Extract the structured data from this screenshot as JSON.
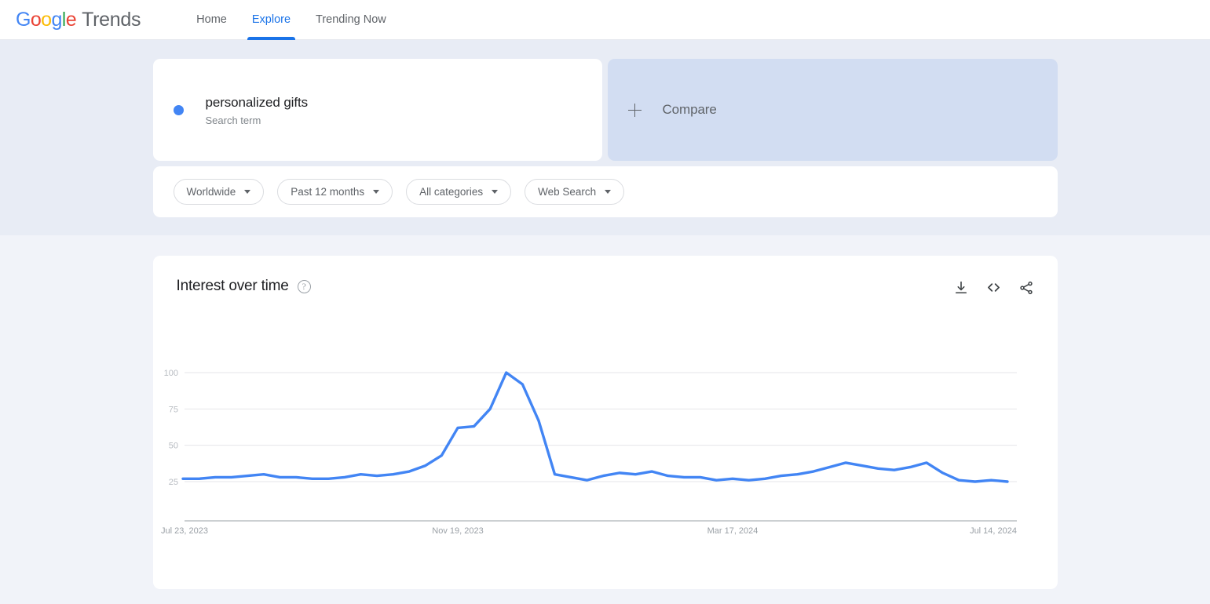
{
  "brand": {
    "google_letters": [
      "G",
      "o",
      "o",
      "g",
      "l",
      "e"
    ],
    "product": "Trends"
  },
  "nav": {
    "items": [
      {
        "label": "Home",
        "active": false
      },
      {
        "label": "Explore",
        "active": true
      },
      {
        "label": "Trending Now",
        "active": false
      }
    ]
  },
  "term": {
    "name": "personalized gifts",
    "type": "Search term",
    "color": "#4285f4"
  },
  "compare": {
    "label": "Compare"
  },
  "filters": [
    {
      "label": "Worldwide"
    },
    {
      "label": "Past 12 months"
    },
    {
      "label": "All categories"
    },
    {
      "label": "Web Search"
    }
  ],
  "chart_card": {
    "title": "Interest over time",
    "help_glyph": "?",
    "actions": [
      {
        "name": "download-icon",
        "title": "Download"
      },
      {
        "name": "embed-icon",
        "title": "Embed"
      },
      {
        "name": "share-icon",
        "title": "Share"
      }
    ]
  },
  "chart_data": {
    "type": "line",
    "title": "Interest over time",
    "xlabel": "",
    "ylabel": "",
    "ylim": [
      0,
      100
    ],
    "yticks": [
      25,
      50,
      75,
      100
    ],
    "grid": true,
    "legend": false,
    "line_color": "#4285f4",
    "line_width": 3.4,
    "xtick_labels": [
      "Jul 23, 2023",
      "Nov 19, 2023",
      "Mar 17, 2024",
      "Jul 14, 2024"
    ],
    "xtick_indices": [
      0,
      17,
      34,
      51
    ],
    "x": [
      "Jul 23, 2023",
      "Jul 30, 2023",
      "Aug 6, 2023",
      "Aug 13, 2023",
      "Aug 20, 2023",
      "Aug 27, 2023",
      "Sep 3, 2023",
      "Sep 10, 2023",
      "Sep 17, 2023",
      "Sep 24, 2023",
      "Oct 1, 2023",
      "Oct 8, 2023",
      "Oct 15, 2023",
      "Oct 22, 2023",
      "Oct 29, 2023",
      "Nov 5, 2023",
      "Nov 12, 2023",
      "Nov 19, 2023",
      "Nov 26, 2023",
      "Dec 3, 2023",
      "Dec 10, 2023",
      "Dec 17, 2023",
      "Dec 24, 2023",
      "Dec 31, 2023",
      "Jan 7, 2024",
      "Jan 14, 2024",
      "Jan 21, 2024",
      "Jan 28, 2024",
      "Feb 4, 2024",
      "Feb 11, 2024",
      "Feb 18, 2024",
      "Feb 25, 2024",
      "Mar 3, 2024",
      "Mar 10, 2024",
      "Mar 17, 2024",
      "Mar 24, 2024",
      "Mar 31, 2024",
      "Apr 7, 2024",
      "Apr 14, 2024",
      "Apr 21, 2024",
      "Apr 28, 2024",
      "May 5, 2024",
      "May 12, 2024",
      "May 19, 2024",
      "May 26, 2024",
      "Jun 2, 2024",
      "Jun 9, 2024",
      "Jun 16, 2024",
      "Jun 23, 2024",
      "Jun 30, 2024",
      "Jul 7, 2024",
      "Jul 14, 2024"
    ],
    "series": [
      {
        "name": "personalized gifts",
        "color": "#4285f4",
        "values": [
          27,
          27,
          28,
          28,
          29,
          30,
          28,
          28,
          27,
          27,
          28,
          30,
          29,
          30,
          32,
          36,
          43,
          62,
          63,
          75,
          100,
          92,
          67,
          30,
          28,
          26,
          29,
          31,
          30,
          32,
          29,
          28,
          28,
          26,
          27,
          26,
          27,
          29,
          30,
          32,
          35,
          38,
          36,
          34,
          33,
          35,
          38,
          31,
          26,
          25,
          26,
          25
        ]
      }
    ]
  }
}
